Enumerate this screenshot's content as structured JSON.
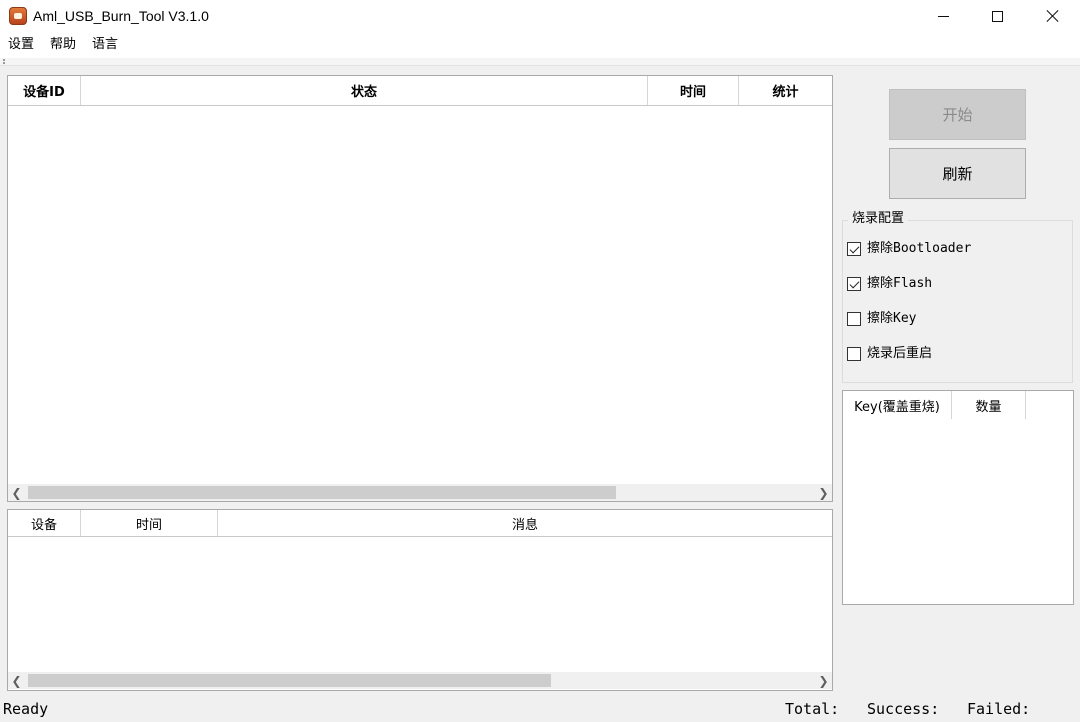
{
  "window": {
    "title": "Aml_USB_Burn_Tool V3.1.0"
  },
  "menu": {
    "items": [
      "设置",
      "帮助",
      "语言"
    ]
  },
  "device_list": {
    "columns": [
      "设备ID",
      "状态",
      "时间",
      "统计"
    ],
    "rows": []
  },
  "log_list": {
    "columns": [
      "设备",
      "时间",
      "消息"
    ],
    "rows": []
  },
  "buttons": {
    "start_label": "开始",
    "refresh_label": "刷新"
  },
  "burn_config": {
    "title": "烧录配置",
    "options": [
      {
        "label": "擦除Bootloader",
        "checked": true
      },
      {
        "label": "擦除Flash",
        "checked": true
      },
      {
        "label": "擦除Key",
        "checked": false
      },
      {
        "label": "烧录后重启",
        "checked": false
      }
    ]
  },
  "key_list": {
    "columns": [
      "Key(覆盖重烧)",
      "数量"
    ],
    "rows": []
  },
  "status": {
    "ready": "Ready",
    "total": "Total:",
    "success": "Success:",
    "failed": "Failed:"
  },
  "icons": {
    "app": "app-icon",
    "minimize": "minimize-icon",
    "maximize": "maximize-icon",
    "close": "close-icon",
    "left": "chevron-left-icon",
    "right": "chevron-right-icon"
  }
}
